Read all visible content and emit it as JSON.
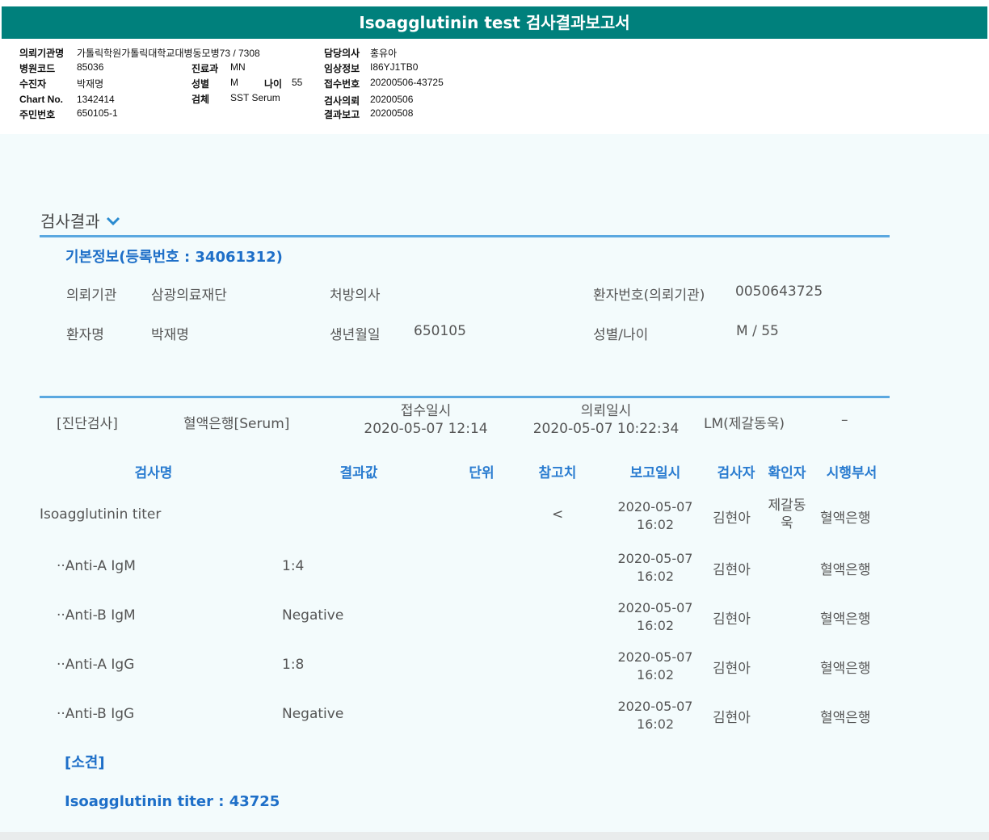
{
  "title": "Isoagglutinin test 검사결과보고서",
  "header": {
    "col1": [
      {
        "label": "의뢰기관명",
        "value": "가톨릭학원가톨릭대학교대병동모병73 / 7308"
      },
      {
        "label": "병원코드",
        "value": "85036"
      },
      {
        "label": "수진자",
        "value": "박재명"
      },
      {
        "label": "Chart No.",
        "value": "1342414"
      },
      {
        "label": "주민번호",
        "value": "650105-1"
      }
    ],
    "col2": [
      {
        "label": "진료과",
        "value": "MN"
      },
      {
        "label": "성별",
        "value": "M"
      },
      {
        "label": "검체",
        "value": "SST Serum"
      }
    ],
    "age": {
      "label": "나이",
      "value": "55"
    },
    "col3": [
      {
        "label": "담당의사",
        "value": "홍유아"
      },
      {
        "label": "임상정보",
        "value": "I86YJ1TB0"
      },
      {
        "label": "접수번호",
        "value": "20200506-43725"
      },
      {
        "label": "검사의뢰",
        "value": "20200506"
      },
      {
        "label": "결과보고",
        "value": "20200508"
      }
    ]
  },
  "section": {
    "title": "검사결과",
    "basic_info_heading": "기본정보(등록번호 : 34061312)",
    "basic": {
      "institution_label": "의뢰기관",
      "institution_value": "삼광의료재단",
      "doctor_label": "처방의사",
      "doctor_value": "",
      "patient_no_label": "환자번호(의뢰기관)",
      "patient_no_value": "0050643725",
      "patient_name_label": "환자명",
      "patient_name_value": "박재명",
      "birth_label": "생년월일",
      "birth_value": "650105",
      "sex_age_label": "성별/나이",
      "sex_age_value": "M / 55"
    },
    "test_info": {
      "category": "[진단검사]",
      "dept": "혈액은행[Serum]",
      "received_label": "접수일시",
      "received_value": "2020-05-07 12:14",
      "requested_label": "의뢰일시",
      "requested_value": "2020-05-07 10:22:34",
      "lm": "LM(제갈동욱)",
      "dash": "–"
    }
  },
  "table": {
    "columns": [
      "검사명",
      "결과값",
      "단위",
      "참고치",
      "보고일시",
      "검사자",
      "확인자",
      "시행부서"
    ],
    "rows": [
      {
        "name": "Isoagglutinin titer",
        "result": "",
        "unit": "",
        "ref": "<",
        "date": "2020-05-07",
        "time": "16:02",
        "tester": "김현아",
        "confirmer_1": "제갈동",
        "confirmer_2": "욱",
        "dept": "혈액은행"
      },
      {
        "name": "··Anti-A IgM",
        "result": "1:4",
        "unit": "",
        "ref": "",
        "date": "2020-05-07",
        "time": "16:02",
        "tester": "김현아",
        "confirmer_1": "",
        "confirmer_2": "",
        "dept": "혈액은행"
      },
      {
        "name": "··Anti-B IgM",
        "result": "Negative",
        "unit": "",
        "ref": "",
        "date": "2020-05-07",
        "time": "16:02",
        "tester": "김현아",
        "confirmer_1": "",
        "confirmer_2": "",
        "dept": "혈액은행"
      },
      {
        "name": "··Anti-A IgG",
        "result": "1:8",
        "unit": "",
        "ref": "",
        "date": "2020-05-07",
        "time": "16:02",
        "tester": "김현아",
        "confirmer_1": "",
        "confirmer_2": "",
        "dept": "혈액은행"
      },
      {
        "name": "··Anti-B IgG",
        "result": "Negative",
        "unit": "",
        "ref": "",
        "date": "2020-05-07",
        "time": "16:02",
        "tester": "김현아",
        "confirmer_1": "",
        "confirmer_2": "",
        "dept": "혈액은행"
      }
    ]
  },
  "opinion": {
    "heading": "[소견]",
    "text": "Isoagglutinin titer : 43725"
  }
}
